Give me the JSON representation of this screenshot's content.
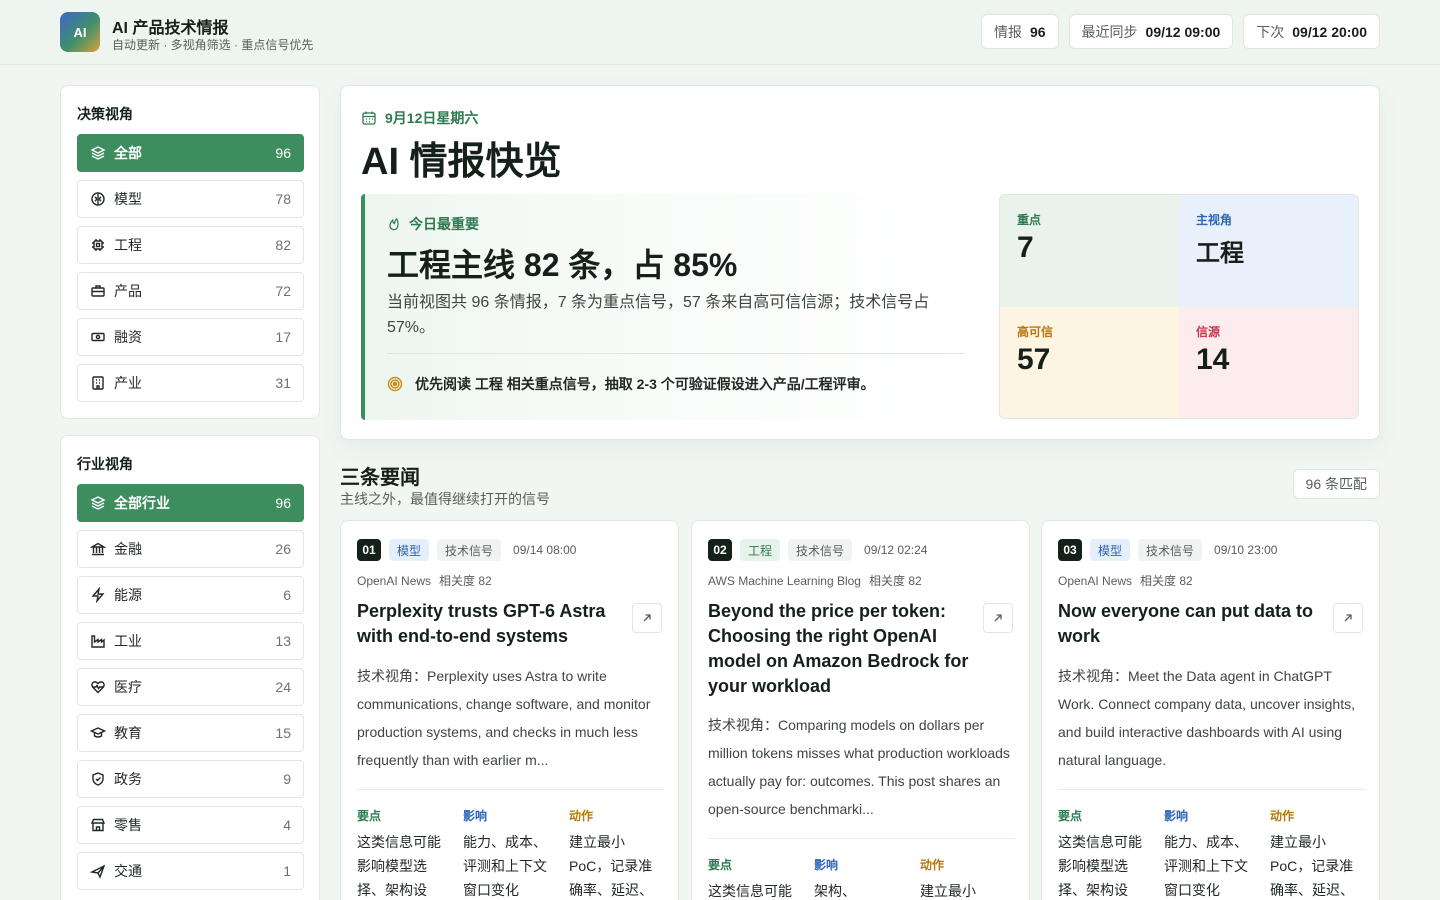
{
  "app": {
    "logo": "AI",
    "title": "AI 产品技术情报",
    "subtitle": "自动更新 · 多视角筛选 · 重点信号优先"
  },
  "header_pills": [
    {
      "label": "情报",
      "value": "96"
    },
    {
      "label": "最近同步",
      "value": "09/12 09:00"
    },
    {
      "label": "下次",
      "value": "09/12 20:00"
    }
  ],
  "sidebar": {
    "decision": {
      "title": "决策视角",
      "items": [
        {
          "label": "全部",
          "count": "96",
          "icon": "layers-icon",
          "active": true
        },
        {
          "label": "模型",
          "count": "78",
          "icon": "brain-icon"
        },
        {
          "label": "工程",
          "count": "82",
          "icon": "cpu-icon"
        },
        {
          "label": "产品",
          "count": "72",
          "icon": "briefcase-icon"
        },
        {
          "label": "融资",
          "count": "17",
          "icon": "banknote-icon"
        },
        {
          "label": "产业",
          "count": "31",
          "icon": "building-icon"
        }
      ]
    },
    "industry": {
      "title": "行业视角",
      "items": [
        {
          "label": "全部行业",
          "count": "96",
          "icon": "layers-icon",
          "active": true
        },
        {
          "label": "金融",
          "count": "26",
          "icon": "bank-icon"
        },
        {
          "label": "能源",
          "count": "6",
          "icon": "zap-icon"
        },
        {
          "label": "工业",
          "count": "13",
          "icon": "factory-icon"
        },
        {
          "label": "医疗",
          "count": "24",
          "icon": "heart-pulse-icon"
        },
        {
          "label": "教育",
          "count": "15",
          "icon": "graduation-cap-icon"
        },
        {
          "label": "政务",
          "count": "9",
          "icon": "shield-icon"
        },
        {
          "label": "零售",
          "count": "4",
          "icon": "store-icon"
        },
        {
          "label": "交通",
          "count": "1",
          "icon": "plane-icon"
        }
      ]
    }
  },
  "hero": {
    "date": "9月12日星期六",
    "title": "AI 情报快览",
    "focus": {
      "label": "今日最重要",
      "headline": "工程主线 82 条，占 85%",
      "body": "当前视图共 96 条情报，7 条为重点信号，57 条来自高可信信源；技术信号占 57%。",
      "tip": "优先阅读 工程 相关重点信号，抽取 2-3 个可验证假设进入产品/工程评审。"
    },
    "stats": [
      {
        "label": "重点",
        "value": "7"
      },
      {
        "label": "主视角",
        "value": "工程"
      },
      {
        "label": "高可信",
        "value": "57"
      },
      {
        "label": "信源",
        "value": "14"
      }
    ]
  },
  "section": {
    "title": "三条要闻",
    "subtitle": "主线之外，最值得继续打开的信号",
    "match": "96 条匹配"
  },
  "cards": [
    {
      "num": "01",
      "tag": "模型",
      "signal": "技术信号",
      "time": "09/14 08:00",
      "source": "OpenAI News",
      "relevance": "相关度 82",
      "title": "Perplexity trusts GPT-6 Astra with end-to-end systems",
      "summary": "技术视角：Perplexity uses Astra to write communications, change software, and monitor production systems, and checks in much less frequently than with earlier m...",
      "key_label": "要点",
      "key": "这类信息可能影响模型选择、架构设",
      "impact_label": "影响",
      "impact": "能力、成本、评测和上下文窗口变化",
      "action_label": "动作",
      "action": "建立最小 PoC，记录准确率、延迟、"
    },
    {
      "num": "02",
      "tag": "工程",
      "signal": "技术信号",
      "time": "09/12 02:24",
      "source": "AWS Machine Learning Blog",
      "relevance": "相关度 82",
      "title": "Beyond the price per token: Choosing the right OpenAI model on Amazon Bedrock for your workload",
      "summary": "技术视角：Comparing models on dollars per million tokens misses what production workloads actually pay for: outcomes. This post shares an open-source benchmarki...",
      "key_label": "要点",
      "key": "这类信息可能",
      "impact_label": "影响",
      "impact": "架构、",
      "action_label": "动作",
      "action": "建立最小"
    },
    {
      "num": "03",
      "tag": "模型",
      "signal": "技术信号",
      "time": "09/10 23:00",
      "source": "OpenAI News",
      "relevance": "相关度 82",
      "title": "Now everyone can put data to work",
      "summary": "技术视角：Meet the Data agent in ChatGPT Work. Connect company data, uncover insights, and build interactive dashboards with AI using natural language.",
      "key_label": "要点",
      "key": "这类信息可能影响模型选择、架构设",
      "impact_label": "影响",
      "impact": "能力、成本、评测和上下文窗口变化",
      "action_label": "动作",
      "action": "建立最小 PoC，记录准确率、延迟、"
    }
  ],
  "colors": {
    "accent": "#3d8d5f",
    "blue": "#2e64b8",
    "amber": "#b9760f",
    "red": "#c8394f"
  }
}
